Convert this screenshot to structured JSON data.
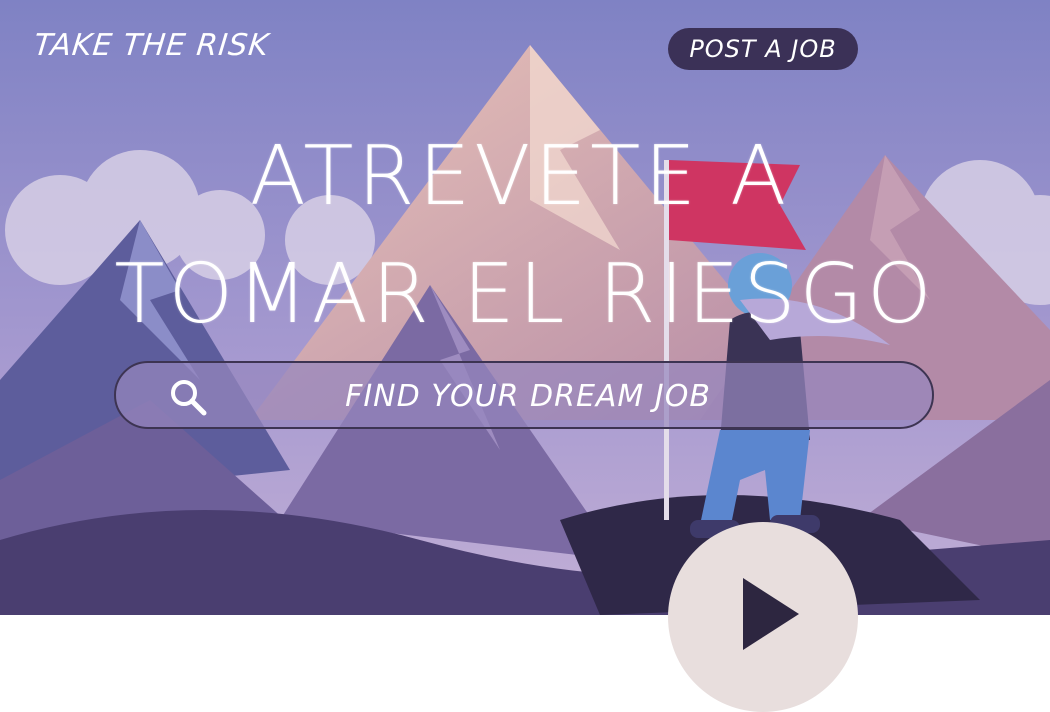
{
  "header": {
    "brand": "TAKE THE RISK",
    "post_job_label": "POST A JOB"
  },
  "hero": {
    "headline_line1": "ATREVETE A",
    "headline_line2": "TOMAR EL RIESGO"
  },
  "search": {
    "placeholder": "FIND YOUR DREAM JOB",
    "icon": "search-icon"
  },
  "play": {
    "icon": "play-icon"
  },
  "colors": {
    "sky_top": "#7f82c4",
    "sky_bottom": "#b7a9d3",
    "button_dark": "#3b3157",
    "play_bg": "#e8dedd",
    "flag": "#cf3562"
  }
}
